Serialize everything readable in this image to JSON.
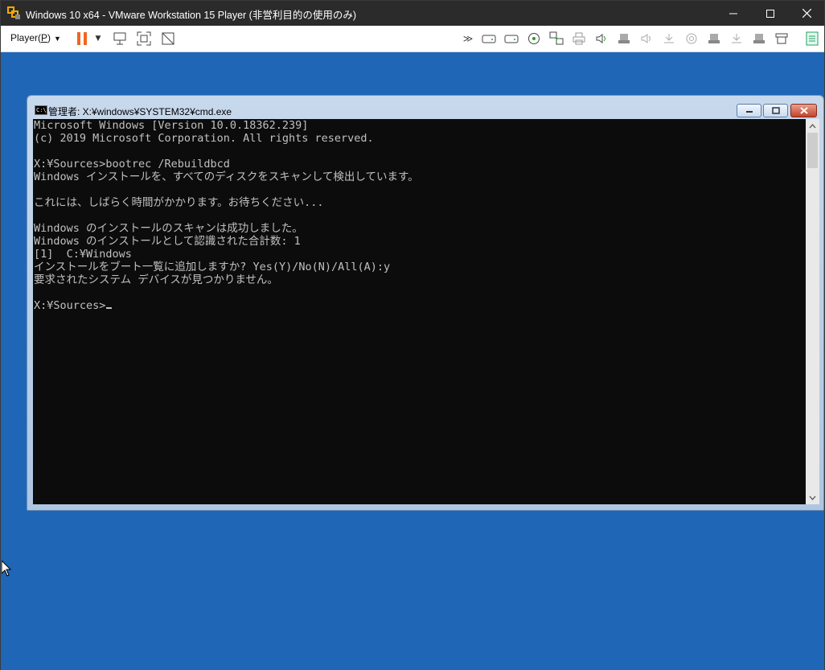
{
  "host_window": {
    "title": "Windows 10 x64 - VMware Workstation 15 Player (非営利目的の使用のみ)",
    "controls": {
      "minimize": "minimize-icon",
      "maximize": "maximize-icon",
      "close": "close-icon"
    }
  },
  "toolbar": {
    "player_menu_label": "Player(",
    "player_menu_key": "P",
    "player_menu_end": ")",
    "icons": [
      "pause-icon",
      "send-ctrl-alt-del-icon",
      "fullscreen-icon",
      "unity-icon",
      "more-icon",
      "hard-disk-icon",
      "hard-disk-icon",
      "cd-dvd-icon",
      "network-adapter-icon",
      "printer-icon",
      "sound-card-icon",
      "usb-device-icon",
      "speaker-icon",
      "bluetooth-icon",
      "camera-icon",
      "usb-device-icon",
      "bluetooth-icon",
      "usb-device-icon",
      "removable-device-icon",
      "message-log-icon"
    ],
    "accent_color": "#f26522"
  },
  "guest_desktop": {
    "background_color": "#1f66b6"
  },
  "cmd_window": {
    "title": "管理者: X:¥windows¥SYSTEM32¥cmd.exe",
    "icon_text": "C:\\",
    "lines": [
      "Microsoft Windows [Version 10.0.18362.239]",
      "(c) 2019 Microsoft Corporation. All rights reserved.",
      "",
      "X:¥Sources>bootrec /Rebuildbcd",
      "Windows インストールを、すべてのディスクをスキャンして検出しています。",
      "",
      "これには、しばらく時間がかかります。お待ちください...",
      "",
      "Windows のインストールのスキャンは成功しました。",
      "Windows のインストールとして認識された合計数: 1",
      "[1]  C:¥Windows",
      "インストールをブート一覧に追加しますか? Yes(Y)/No(N)/All(A):y",
      "要求されたシステム デバイスが見つかりません。",
      ""
    ],
    "prompt": "X:¥Sources>"
  }
}
